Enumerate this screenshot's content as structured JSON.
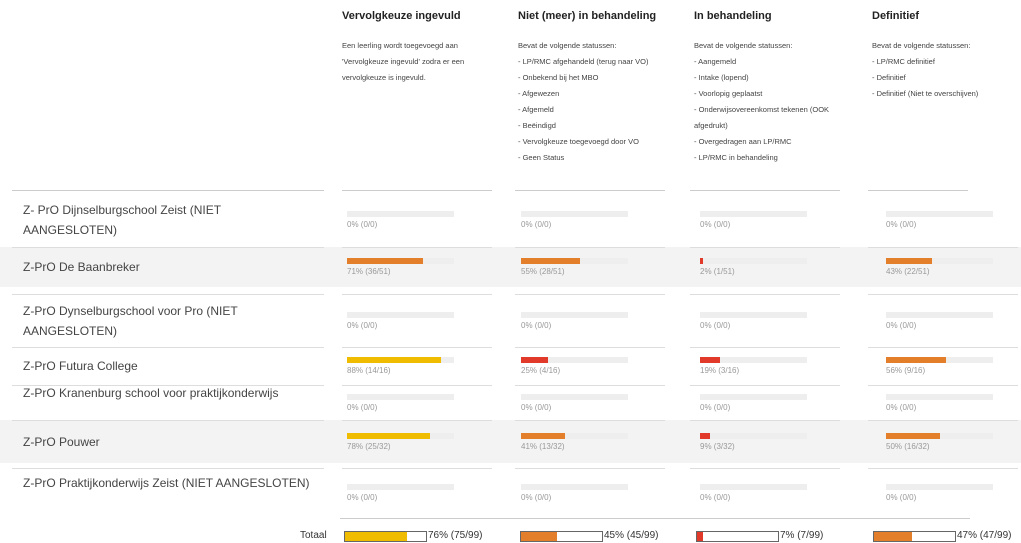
{
  "colors": {
    "yellow": "#f0bc00",
    "orange": "#e37e2a",
    "red": "#e23a2a",
    "track": "#eeeeee"
  },
  "columns": [
    {
      "title": "Vervolgkeuze ingevuld",
      "description": [
        "Een leerling wordt toegevoegd aan 'Vervolgkeuze ingevuld' zodra er een vervolgkeuze is ingevuld."
      ]
    },
    {
      "title": "Niet (meer) in behandeling",
      "description": [
        "Bevat de volgende statussen:",
        "- LP/RMC afgehandeld (terug naar VO)",
        "- Onbekend bij het MBO",
        "- Afgewezen",
        "- Afgemeld",
        "- Beëindigd",
        "- Vervolgkeuze toegevoegd door VO",
        "- Geen Status"
      ]
    },
    {
      "title": "In behandeling",
      "description": [
        "Bevat de volgende statussen:",
        "- Aangemeld",
        "- Intake (lopend)",
        "- Voorlopig geplaatst",
        "- Onderwijsovereenkomst tekenen (OOK afgedrukt)",
        "- Overgedragen aan LP/RMC",
        "- LP/RMC in behandeling"
      ]
    },
    {
      "title": "Definitief",
      "description": [
        "Bevat de volgende statussen:",
        "- LP/RMC definitief",
        "- Definitief",
        "- Definitief (Niet te overschijven)"
      ]
    }
  ],
  "rows": [
    {
      "school": "Z- PrO Dijnselburgschool Zeist (NIET AANGESLOTEN)",
      "cells": [
        {
          "text": "0% (0/0)",
          "fraction": 0,
          "color": "yellow"
        },
        {
          "text": "0% (0/0)",
          "fraction": 0,
          "color": "orange"
        },
        {
          "text": "0% (0/0)",
          "fraction": 0,
          "color": "red"
        },
        {
          "text": "0% (0/0)",
          "fraction": 0,
          "color": "orange"
        }
      ]
    },
    {
      "school": "Z-PrO De Baanbreker",
      "cells": [
        {
          "text": "71% (36/51)",
          "fraction": 0.71,
          "color": "orange"
        },
        {
          "text": "55% (28/51)",
          "fraction": 0.55,
          "color": "orange"
        },
        {
          "text": "2% (1/51)",
          "fraction": 0.02,
          "color": "red"
        },
        {
          "text": "43% (22/51)",
          "fraction": 0.43,
          "color": "orange"
        }
      ]
    },
    {
      "school": "Z-PrO Dynselburgschool voor Pro (NIET AANGESLOTEN)",
      "cells": [
        {
          "text": "0% (0/0)",
          "fraction": 0,
          "color": "yellow"
        },
        {
          "text": "0% (0/0)",
          "fraction": 0,
          "color": "orange"
        },
        {
          "text": "0% (0/0)",
          "fraction": 0,
          "color": "red"
        },
        {
          "text": "0% (0/0)",
          "fraction": 0,
          "color": "orange"
        }
      ]
    },
    {
      "school": "Z-PrO Futura College",
      "cells": [
        {
          "text": "88% (14/16)",
          "fraction": 0.88,
          "color": "yellow"
        },
        {
          "text": "25% (4/16)",
          "fraction": 0.25,
          "color": "red"
        },
        {
          "text": "19% (3/16)",
          "fraction": 0.19,
          "color": "red"
        },
        {
          "text": "56% (9/16)",
          "fraction": 0.56,
          "color": "orange"
        }
      ]
    },
    {
      "school": "Z-PrO Kranenburg school voor praktijkonderwijs",
      "cells": [
        {
          "text": "0% (0/0)",
          "fraction": 0,
          "color": "yellow"
        },
        {
          "text": "0% (0/0)",
          "fraction": 0,
          "color": "orange"
        },
        {
          "text": "0% (0/0)",
          "fraction": 0,
          "color": "red"
        },
        {
          "text": "0% (0/0)",
          "fraction": 0,
          "color": "orange"
        }
      ]
    },
    {
      "school": "Z-PrO Pouwer",
      "cells": [
        {
          "text": "78% (25/32)",
          "fraction": 0.78,
          "color": "yellow"
        },
        {
          "text": "41% (13/32)",
          "fraction": 0.41,
          "color": "orange"
        },
        {
          "text": "9% (3/32)",
          "fraction": 0.09,
          "color": "red"
        },
        {
          "text": "50% (16/32)",
          "fraction": 0.5,
          "color": "orange"
        }
      ]
    },
    {
      "school": "Z-PrO Praktijkonderwijs Zeist (NIET AANGESLOTEN)",
      "cells": [
        {
          "text": "0% (0/0)",
          "fraction": 0,
          "color": "yellow"
        },
        {
          "text": "0% (0/0)",
          "fraction": 0,
          "color": "orange"
        },
        {
          "text": "0% (0/0)",
          "fraction": 0,
          "color": "red"
        },
        {
          "text": "0% (0/0)",
          "fraction": 0,
          "color": "orange"
        }
      ]
    }
  ],
  "totals": {
    "label": "Totaal",
    "cells": [
      {
        "text": "76% (75/99)",
        "fraction": 0.76,
        "color": "yellow"
      },
      {
        "text": "45% (45/99)",
        "fraction": 0.45,
        "color": "orange"
      },
      {
        "text": "7% (7/99)",
        "fraction": 0.07,
        "color": "red"
      },
      {
        "text": "47% (47/99)",
        "fraction": 0.47,
        "color": "orange"
      }
    ]
  }
}
